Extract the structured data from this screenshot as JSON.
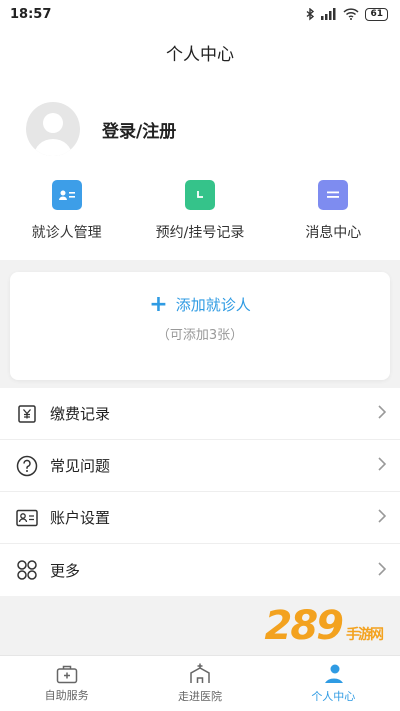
{
  "status_bar": {
    "time": "18:57",
    "battery": "61"
  },
  "header": {
    "title": "个人中心"
  },
  "profile": {
    "login_label": "登录/注册"
  },
  "shortcuts": [
    {
      "label": "就诊人管理",
      "icon": "patient-card-icon",
      "color": "#3d9ee8"
    },
    {
      "label": "预约/挂号记录",
      "icon": "calendar-clock-icon",
      "color": "#35c38a"
    },
    {
      "label": "消息中心",
      "icon": "message-icon",
      "color": "#7e8cf0"
    }
  ],
  "add_card": {
    "label": "添加就诊人",
    "sub": "（可添加3张）"
  },
  "menu": [
    {
      "label": "缴费记录",
      "icon": "yuan-receipt-icon"
    },
    {
      "label": "常见问题",
      "icon": "question-icon"
    },
    {
      "label": "账户设置",
      "icon": "id-card-icon"
    },
    {
      "label": "更多",
      "icon": "grid-more-icon"
    }
  ],
  "tabs": [
    {
      "label": "自助服务",
      "icon": "medical-kit-icon"
    },
    {
      "label": "走进医院",
      "icon": "hospital-icon"
    },
    {
      "label": "个人中心",
      "icon": "person-icon",
      "active": true
    }
  ],
  "colors": {
    "accent": "#2f9be3"
  },
  "watermark": {
    "text": "289",
    "sub": "手游网"
  }
}
